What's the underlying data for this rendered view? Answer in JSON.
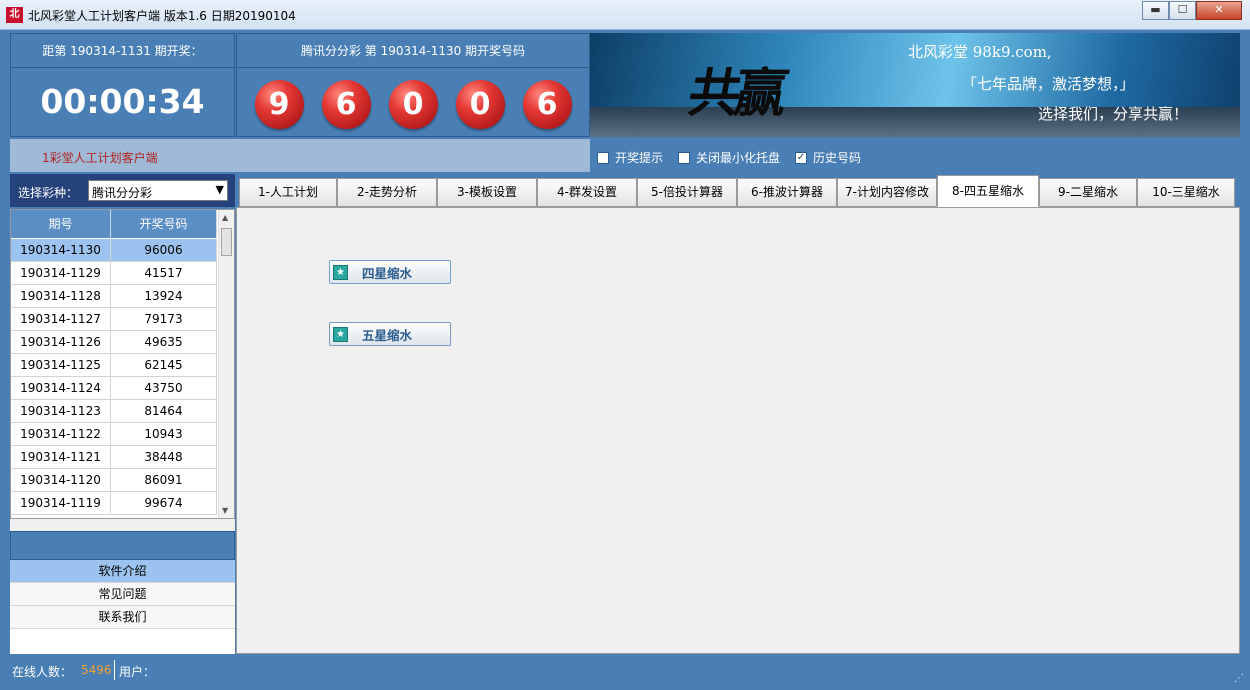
{
  "window": {
    "title": "北风彩堂人工计划客户端   版本1.6  日期20190104",
    "icon_text": "北",
    "buttons": {
      "minimize": "▬",
      "maximize": "☐",
      "close": "✕"
    }
  },
  "countdown": {
    "label": "距第 190314-1131 期开奖：",
    "time": "00:00:34"
  },
  "latest_draw": {
    "label": "腾讯分分彩 第 190314-1130 期开奖号码",
    "balls": [
      "9",
      "6",
      "0",
      "0",
      "6"
    ]
  },
  "banner": {
    "logo_text": "共赢",
    "lines": [
      "北风彩堂 98k9.com,",
      "「七年品牌，激活梦想，」",
      "选择我们，分享共赢！"
    ]
  },
  "subbar": {
    "client_name": "1彩堂人工计划客户端",
    "checkboxes": [
      {
        "label": "开奖提示",
        "checked": false,
        "mark": ""
      },
      {
        "label": "关闭最小化托盘",
        "checked": false,
        "mark": ""
      },
      {
        "label": "历史号码",
        "checked": true,
        "mark": "✓"
      }
    ]
  },
  "lottery_selector": {
    "label": "选择彩种：",
    "value": "腾讯分分彩",
    "arrow": "▼"
  },
  "history_table": {
    "headers": [
      "期号",
      "开奖号码"
    ],
    "rows": [
      [
        "190314-1130",
        "96006"
      ],
      [
        "190314-1129",
        "41517"
      ],
      [
        "190314-1128",
        "13924"
      ],
      [
        "190314-1127",
        "79173"
      ],
      [
        "190314-1126",
        "49635"
      ],
      [
        "190314-1125",
        "62145"
      ],
      [
        "190314-1124",
        "43750"
      ],
      [
        "190314-1123",
        "81464"
      ],
      [
        "190314-1122",
        "10943"
      ],
      [
        "190314-1121",
        "38448"
      ],
      [
        "190314-1120",
        "86091"
      ],
      [
        "190314-1119",
        "99674"
      ]
    ],
    "scroll_up": "▲",
    "scroll_down": "▼"
  },
  "left_nav": {
    "items": [
      "软件介绍",
      "常见问题",
      "联系我们"
    ]
  },
  "tabs": [
    "1-人工计划",
    "2-走势分析",
    "3-模板设置",
    "4-群发设置",
    "5-倍投计算器",
    "6-推波计算器",
    "7-计划内容修改",
    "8-四五星缩水",
    "9-二星缩水",
    "10-三星缩水"
  ],
  "content": {
    "buttons": [
      {
        "label": "四星缩水",
        "icon": "★"
      },
      {
        "label": "五星缩水",
        "icon": "★"
      }
    ]
  },
  "status": {
    "online_label": "在线人数：",
    "online_count": "5496",
    "user_label": "用户：",
    "grip": "⋰"
  },
  "colors": {
    "frame": "#4a7fb5",
    "ball": "#e53935",
    "selected_row": "#9cc3ef",
    "header_dark": "#25427a",
    "client_text": "#b0231d"
  }
}
